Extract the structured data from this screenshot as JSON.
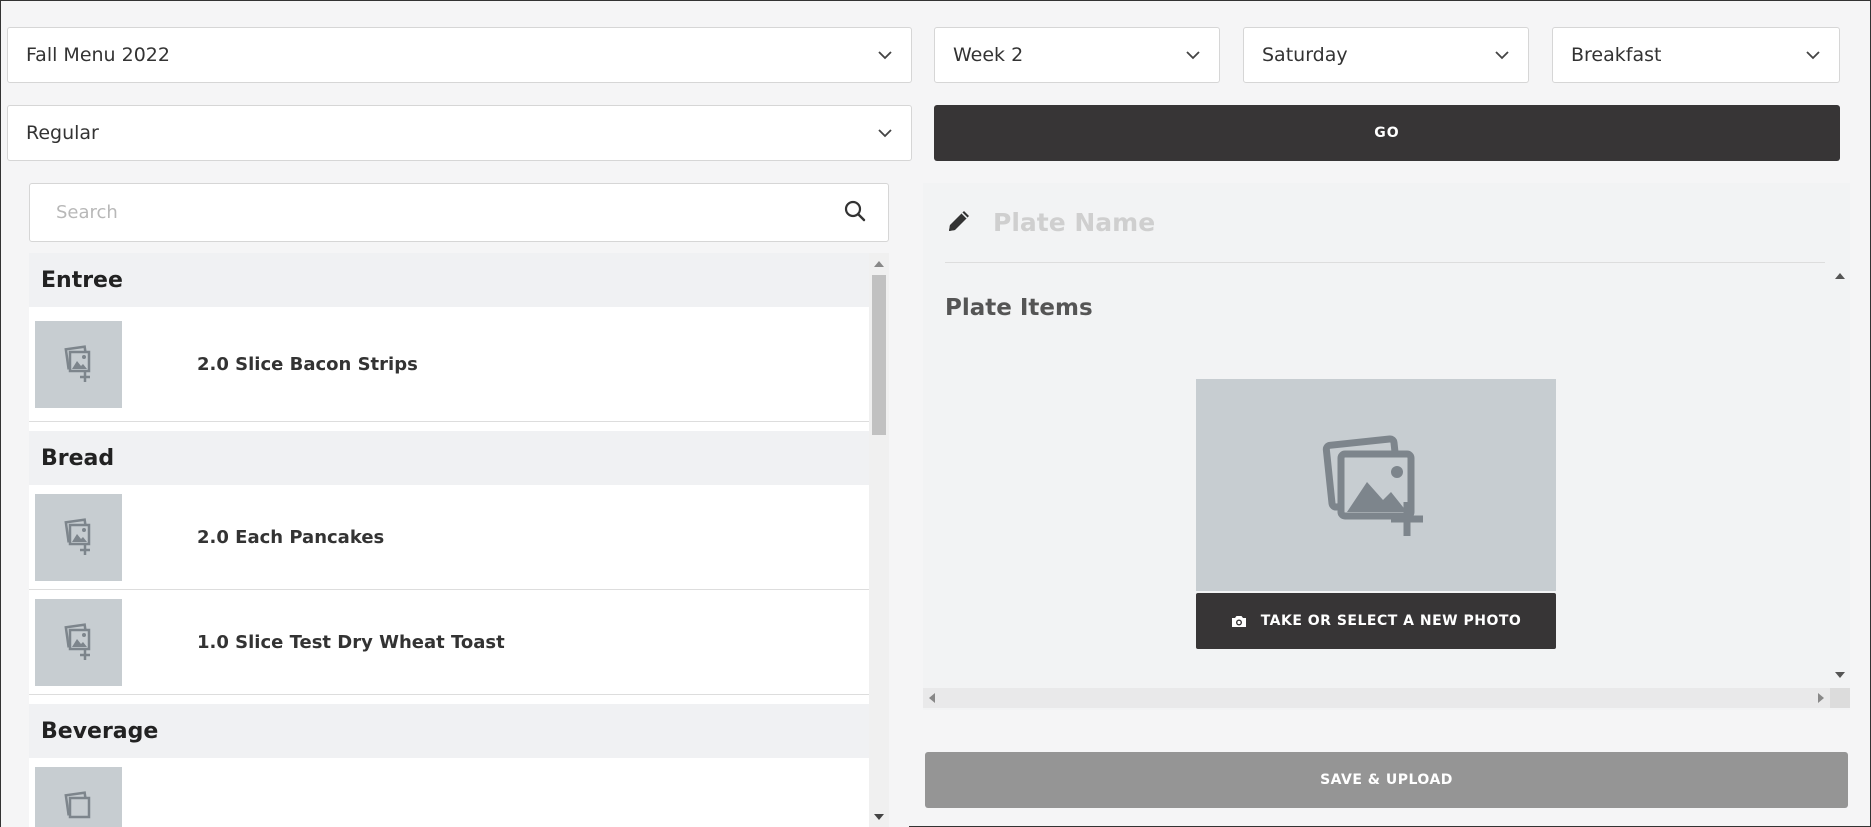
{
  "filters": {
    "menu": "Fall Menu 2022",
    "week": "Week 2",
    "day": "Saturday",
    "meal": "Breakfast",
    "diet": "Regular",
    "go_label": "GO"
  },
  "search": {
    "placeholder": "Search"
  },
  "categories": [
    {
      "name": "Entree",
      "items": [
        "2.0 Slice Bacon Strips"
      ]
    },
    {
      "name": "Bread",
      "items": [
        "2.0 Each Pancakes",
        "1.0 Slice Test Dry Wheat Toast"
      ]
    },
    {
      "name": "Beverage",
      "items": [
        ""
      ]
    }
  ],
  "plate": {
    "name_placeholder": "Plate Name",
    "items_title": "Plate Items",
    "photo_button": "TAKE OR SELECT A NEW PHOTO",
    "save_button": "SAVE & UPLOAD"
  },
  "icons": {
    "chevron": "chevron-down-icon",
    "search": "search-icon",
    "pencil": "pencil-icon",
    "image_add": "image-add-icon",
    "camera": "camera-icon"
  },
  "colors": {
    "dark_button": "#373536",
    "disabled_button": "#959595",
    "thumb_bg": "#c7cdd1"
  }
}
